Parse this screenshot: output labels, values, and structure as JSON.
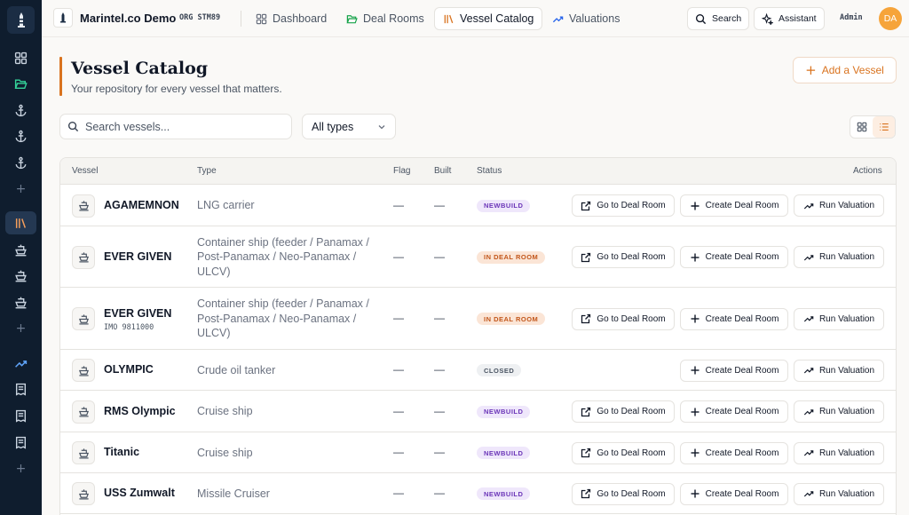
{
  "app": {
    "org_name": "Marintel.co Demo",
    "org_code": "ORG STM89",
    "user_role": "Admin",
    "user_initials": "DA"
  },
  "nav": {
    "tabs": [
      {
        "label": "Dashboard",
        "icon": "grid-icon",
        "active": false
      },
      {
        "label": "Deal Rooms",
        "icon": "folder-open-icon",
        "active": false
      },
      {
        "label": "Vessel Catalog",
        "icon": "library-icon",
        "active": true
      },
      {
        "label": "Valuations",
        "icon": "trending-up-icon",
        "active": false
      }
    ],
    "search_label": "Search",
    "assistant_label": "Assistant"
  },
  "sidebar": {
    "items": [
      {
        "icon": "grid-icon",
        "active": false
      },
      {
        "icon": "folder-open-icon",
        "active": false
      },
      {
        "icon": "anchor-icon",
        "active": false
      },
      {
        "icon": "anchor-icon",
        "active": false
      },
      {
        "icon": "anchor-icon",
        "active": false
      },
      {
        "icon": "plus-icon",
        "active": false
      },
      {
        "icon": "library-icon",
        "active": true
      },
      {
        "icon": "ship-icon",
        "active": false
      },
      {
        "icon": "ship-icon",
        "active": false
      },
      {
        "icon": "ship-icon",
        "active": false
      },
      {
        "icon": "plus-icon",
        "active": false
      },
      {
        "icon": "trending-up-icon",
        "active": false
      },
      {
        "icon": "receipt-icon",
        "active": false
      },
      {
        "icon": "receipt-icon",
        "active": false
      },
      {
        "icon": "receipt-icon",
        "active": false
      },
      {
        "icon": "plus-icon",
        "active": false
      }
    ]
  },
  "page": {
    "title": "Vessel Catalog",
    "subtitle": "Your repository for every vessel that matters.",
    "add_button": "Add a Vessel"
  },
  "filters": {
    "search_placeholder": "Search vessels...",
    "type_value": "All types"
  },
  "table": {
    "columns": [
      "Vessel",
      "Type",
      "Flag",
      "Built",
      "Status",
      "Actions"
    ],
    "action_labels": {
      "go": "Go to Deal Room",
      "create": "Create Deal Room",
      "run": "Run Valuation"
    },
    "rows": [
      {
        "name": "AGAMEMNON",
        "imo": "",
        "type": "LNG carrier",
        "flag": "—",
        "built": "—",
        "status": "NEWBUILD",
        "status_kind": "newbuild",
        "has_deal_room": true
      },
      {
        "name": "EVER GIVEN",
        "imo": "",
        "type": "Container ship (feeder / Panamax / Post-Panamax / Neo-Panamax / ULCV)",
        "flag": "—",
        "built": "—",
        "status": "IN DEAL ROOM",
        "status_kind": "indeal",
        "has_deal_room": true
      },
      {
        "name": "EVER GIVEN",
        "imo": "IMO 9811000",
        "type": "Container ship (feeder / Panamax / Post-Panamax / Neo-Panamax / ULCV)",
        "flag": "—",
        "built": "—",
        "status": "IN DEAL ROOM",
        "status_kind": "indeal",
        "has_deal_room": true
      },
      {
        "name": "OLYMPIC",
        "imo": "",
        "type": "Crude oil tanker",
        "flag": "—",
        "built": "—",
        "status": "CLOSED",
        "status_kind": "closed",
        "has_deal_room": false
      },
      {
        "name": "RMS Olympic",
        "imo": "",
        "type": "Cruise ship",
        "flag": "—",
        "built": "—",
        "status": "NEWBUILD",
        "status_kind": "newbuild",
        "has_deal_room": true
      },
      {
        "name": "Titanic",
        "imo": "",
        "type": "Cruise ship",
        "flag": "—",
        "built": "—",
        "status": "NEWBUILD",
        "status_kind": "newbuild",
        "has_deal_room": true
      },
      {
        "name": "USS Zumwalt",
        "imo": "",
        "type": "Missile Cruiser",
        "flag": "—",
        "built": "—",
        "status": "NEWBUILD",
        "status_kind": "newbuild",
        "has_deal_room": true
      }
    ]
  },
  "colors": {
    "accent": "#d9731f",
    "rail_bg": "#0f1d2e",
    "newbuild": "#6b35b8",
    "in_deal_room": "#c2561a",
    "avatar": "#f6a43a"
  }
}
